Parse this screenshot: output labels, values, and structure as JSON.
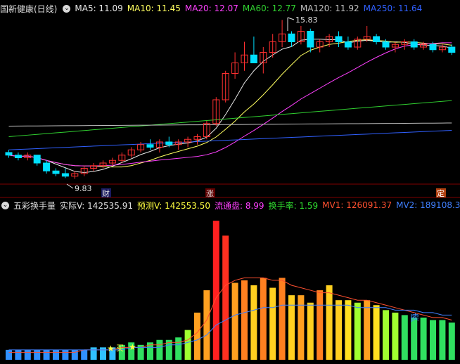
{
  "header": {
    "stock_name": "国新健康(日线)",
    "ma5": "MA5: 11.09",
    "ma10": "MA10: 11.45",
    "ma20": "MA20: 12.07",
    "ma60": "MA60: 12.77",
    "ma120": "MA120: 11.92",
    "ma250": "MA250: 11.64"
  },
  "indicator": {
    "name": "五彩换手量",
    "actual": "实际V: 142535.91",
    "predicted": "预测V: 142553.50",
    "float_shares": "流通盘: 8.99",
    "turnover": "换手率: 1.59",
    "mv1": "MV1: 126091.37",
    "mv2": "MV2: 189108.31"
  },
  "annotations": {
    "high_label": "15.83",
    "low_label": "9.83",
    "marker_cai": "财",
    "marker_zhang": "涨",
    "marker_ding": "定",
    "buy_label": "买",
    "sell_label": "卖"
  },
  "colors": {
    "ma5": "#e8e8e8",
    "ma10": "#ffff60",
    "ma20": "#ff40ff",
    "ma60": "#30d030",
    "ma120": "#c0c0c0",
    "ma250": "#3060ff",
    "up": "#ff3030",
    "down": "#00e0ff",
    "mv1": "#ff5030",
    "mv2": "#4080ff"
  },
  "chart_data": {
    "type": "candlestick",
    "candles": [
      [
        10.8,
        10.9,
        10.6,
        10.7
      ],
      [
        10.7,
        10.8,
        10.5,
        10.6
      ],
      [
        10.6,
        10.8,
        10.5,
        10.7
      ],
      [
        10.7,
        10.7,
        10.3,
        10.4
      ],
      [
        10.4,
        10.5,
        10.0,
        10.1
      ],
      [
        10.1,
        10.2,
        9.9,
        10.0
      ],
      [
        10.0,
        10.2,
        9.83,
        9.9
      ],
      [
        9.9,
        10.1,
        9.8,
        10.0
      ],
      [
        10.0,
        10.3,
        9.9,
        10.2
      ],
      [
        10.2,
        10.4,
        10.1,
        10.3
      ],
      [
        10.3,
        10.5,
        10.2,
        10.4
      ],
      [
        10.4,
        10.6,
        10.3,
        10.5
      ],
      [
        10.5,
        10.8,
        10.4,
        10.7
      ],
      [
        10.7,
        11.0,
        10.6,
        10.9
      ],
      [
        10.9,
        11.2,
        10.8,
        11.1
      ],
      [
        11.1,
        11.3,
        10.9,
        11.0
      ],
      [
        11.0,
        11.3,
        10.8,
        11.2
      ],
      [
        11.2,
        11.4,
        11.0,
        11.1
      ],
      [
        11.1,
        11.3,
        10.9,
        11.2
      ],
      [
        11.2,
        11.4,
        11.0,
        11.3
      ],
      [
        11.3,
        11.5,
        11.1,
        11.4
      ],
      [
        11.4,
        12.0,
        11.3,
        11.9
      ],
      [
        11.9,
        12.9,
        11.8,
        12.8
      ],
      [
        12.8,
        13.9,
        12.7,
        13.8
      ],
      [
        13.8,
        14.6,
        13.6,
        14.2
      ],
      [
        14.2,
        15.0,
        13.9,
        14.5
      ],
      [
        14.5,
        15.2,
        14.2,
        14.2
      ],
      [
        14.2,
        14.8,
        13.8,
        14.6
      ],
      [
        14.6,
        15.3,
        14.4,
        15.0
      ],
      [
        15.0,
        15.83,
        14.8,
        15.3
      ],
      [
        15.3,
        15.4,
        14.8,
        15.0
      ],
      [
        15.0,
        15.6,
        14.9,
        15.4
      ],
      [
        15.4,
        15.5,
        14.6,
        14.8
      ],
      [
        14.8,
        15.1,
        14.6,
        15.0
      ],
      [
        15.0,
        15.3,
        14.8,
        15.2
      ],
      [
        15.2,
        15.4,
        14.8,
        15.0
      ],
      [
        15.0,
        15.2,
        14.7,
        14.8
      ],
      [
        14.8,
        15.2,
        14.7,
        15.1
      ],
      [
        15.1,
        15.6,
        15.0,
        15.2
      ],
      [
        15.2,
        15.3,
        14.9,
        15.0
      ],
      [
        15.0,
        15.1,
        14.7,
        14.8
      ],
      [
        14.8,
        15.0,
        14.6,
        14.9
      ],
      [
        14.9,
        15.1,
        14.7,
        15.0
      ],
      [
        15.0,
        15.1,
        14.7,
        14.8
      ],
      [
        14.8,
        15.0,
        14.7,
        14.9
      ],
      [
        14.9,
        15.0,
        14.6,
        14.7
      ],
      [
        14.7,
        14.9,
        14.6,
        14.8
      ],
      [
        14.8,
        14.9,
        14.5,
        14.6
      ]
    ],
    "volumes": [
      4,
      4,
      4,
      4,
      4,
      4,
      4,
      4,
      4,
      5,
      5,
      5,
      6,
      7,
      6,
      7,
      8,
      8,
      9,
      12,
      19,
      28,
      56,
      50,
      31,
      32,
      30,
      33,
      29,
      33,
      26,
      26,
      23,
      28,
      30,
      24,
      24,
      23,
      24,
      22,
      20,
      19,
      18,
      17,
      17,
      16,
      16,
      15
    ],
    "volume_colors": [
      "#3090ff",
      "#3090ff",
      "#3090ff",
      "#3090ff",
      "#3090ff",
      "#3090ff",
      "#3090ff",
      "#3090ff",
      "#3090ff",
      "#30c0ff",
      "#30c0ff",
      "#30c0ff",
      "#30e060",
      "#30e060",
      "#30e060",
      "#30e060",
      "#30e060",
      "#30e060",
      "#30e060",
      "#a0ff30",
      "#ffa020",
      "#ffa020",
      "#ff2020",
      "#ff3020",
      "#ffa020",
      "#ff8020",
      "#ffd020",
      "#ff8020",
      "#ffd020",
      "#ff8020",
      "#ffd020",
      "#ffa020",
      "#ffd020",
      "#ff8020",
      "#ffd020",
      "#ffd020",
      "#ffe020",
      "#a0ff30",
      "#ffa020",
      "#ffe020",
      "#a0ff30",
      "#a0ff30",
      "#30e060",
      "#30e060",
      "#30e060",
      "#30e060",
      "#30e060",
      "#30e060"
    ],
    "mv1": [
      3,
      3,
      3,
      3,
      3,
      3,
      3,
      3,
      4,
      4,
      4,
      4,
      5,
      5,
      5,
      6,
      6,
      7,
      7,
      8,
      11,
      16,
      25,
      30,
      32,
      33,
      33,
      33,
      32,
      32,
      30,
      29,
      28,
      27,
      27,
      26,
      25,
      24,
      24,
      23,
      22,
      21,
      20,
      19,
      18,
      17,
      17,
      16
    ],
    "mv2": [
      4,
      4,
      4,
      4,
      4,
      4,
      4,
      4,
      4,
      4,
      4,
      4,
      4,
      5,
      5,
      5,
      5,
      6,
      6,
      7,
      8,
      10,
      14,
      16,
      18,
      19,
      20,
      21,
      21,
      22,
      22,
      22,
      22,
      22,
      22,
      22,
      22,
      21,
      21,
      21,
      21,
      20,
      20,
      20,
      19,
      19,
      18,
      18
    ],
    "price_range": [
      9.6,
      16.0
    ],
    "volume_range": [
      0,
      60
    ]
  }
}
